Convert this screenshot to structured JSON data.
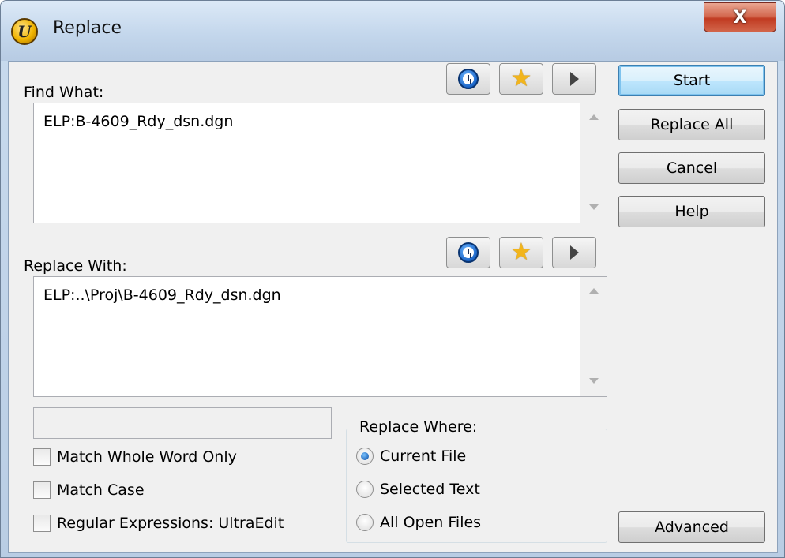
{
  "window": {
    "title": "Replace",
    "close_glyph": "X"
  },
  "find": {
    "label": "Find What:",
    "value": "ELP:B-4609_Rdy_dsn.dgn"
  },
  "replace": {
    "label": "Replace With:",
    "value": "ELP:..\\Proj\\B-4609_Rdy_dsn.dgn"
  },
  "toolbar_icons": [
    "history-clock-icon",
    "favorites-star-icon",
    "expand-arrow-icon"
  ],
  "buttons": {
    "start": "Start",
    "replace_all": "Replace All",
    "cancel": "Cancel",
    "help": "Help",
    "advanced": "Advanced"
  },
  "options": {
    "match_whole_word": "Match Whole Word Only",
    "match_case": "Match Case",
    "regex": "Regular Expressions: UltraEdit"
  },
  "replace_where": {
    "title": "Replace Where:",
    "current_file": "Current File",
    "selected_text": "Selected Text",
    "all_open_files": "All Open Files",
    "selected": "Current File"
  },
  "colors": {
    "accent_default_button": "#3c7fb1",
    "close_button": "#c13b22",
    "dialog_bg": "#f0f0f0"
  }
}
